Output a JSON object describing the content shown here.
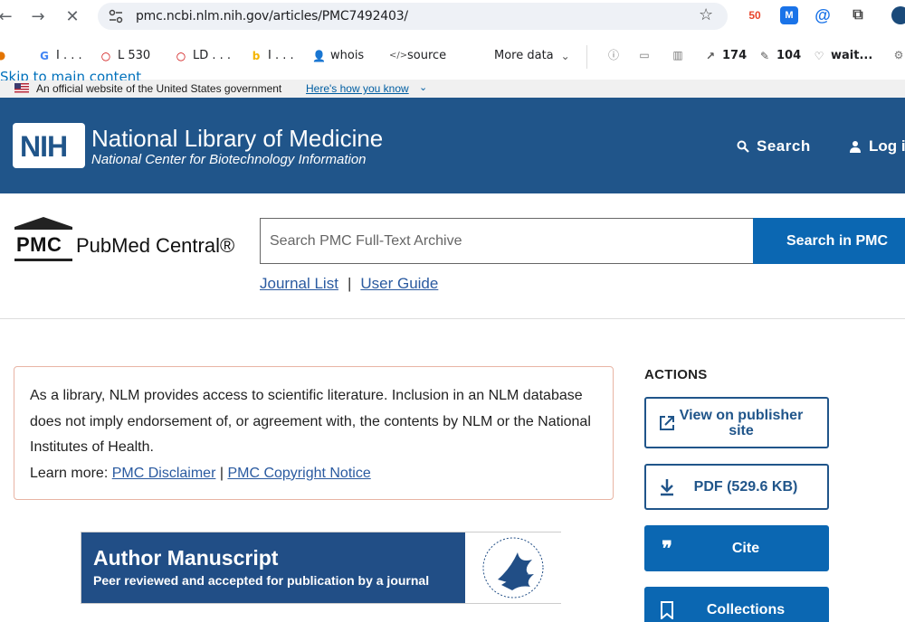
{
  "browser": {
    "url": "pmc.ncbi.nlm.nih.gov/articles/PMC7492403/",
    "extensions": {
      "ext1": "50"
    }
  },
  "bookmarks": [
    {
      "label": "I . . .",
      "icon": "google-icon"
    },
    {
      "label": "L 530",
      "icon": "circle-icon"
    },
    {
      "label": "LD . . .",
      "icon": "circle-icon"
    },
    {
      "label": "I . . .",
      "icon": "bing-icon"
    },
    {
      "label": "whois",
      "icon": "person-icon"
    },
    {
      "label": "source",
      "icon": "code-icon"
    },
    {
      "label": "More data",
      "icon": "chevron-down-icon"
    },
    {
      "label": "174",
      "icon": "external-icon"
    },
    {
      "label": "104",
      "icon": "edit-icon"
    },
    {
      "label": "wait...",
      "icon": "heart-icon"
    }
  ],
  "gov_banner": {
    "skip": "Skip to main content",
    "text": "An official website of the United States government",
    "link": "Here's how you know"
  },
  "nih_header": {
    "logo": "NIH",
    "title": "National Library of Medicine",
    "subtitle": "National Center for Biotechnology Information",
    "search": "Search",
    "login": "Log in"
  },
  "pmc": {
    "logo_box": "PMC",
    "logo_name": "PubMed Central®",
    "search_placeholder": "Search PMC Full-Text Archive",
    "search_button": "Search in PMC",
    "journal_list": "Journal List",
    "user_guide": "User Guide"
  },
  "disclaimer": {
    "text": "As a library, NLM provides access to scientific literature. Inclusion in an NLM database does not imply endorsement of, or agreement with, the contents by NLM or the National Institutes of Health.",
    "learn_more": "Learn more:",
    "link1": "PMC Disclaimer",
    "sep": "|",
    "link2": "PMC Copyright Notice"
  },
  "manuscript": {
    "title": "Author Manuscript",
    "subtitle": "Peer reviewed and accepted for publication by a journal"
  },
  "actions": {
    "heading": "ACTIONS",
    "view_publisher": "View on publisher site",
    "pdf": "PDF (529.6 KB)",
    "cite": "Cite",
    "collections": "Collections"
  },
  "colors": {
    "nih_blue": "#20558a",
    "action_blue": "#0b67b2",
    "link_blue": "#2a5aa0"
  }
}
